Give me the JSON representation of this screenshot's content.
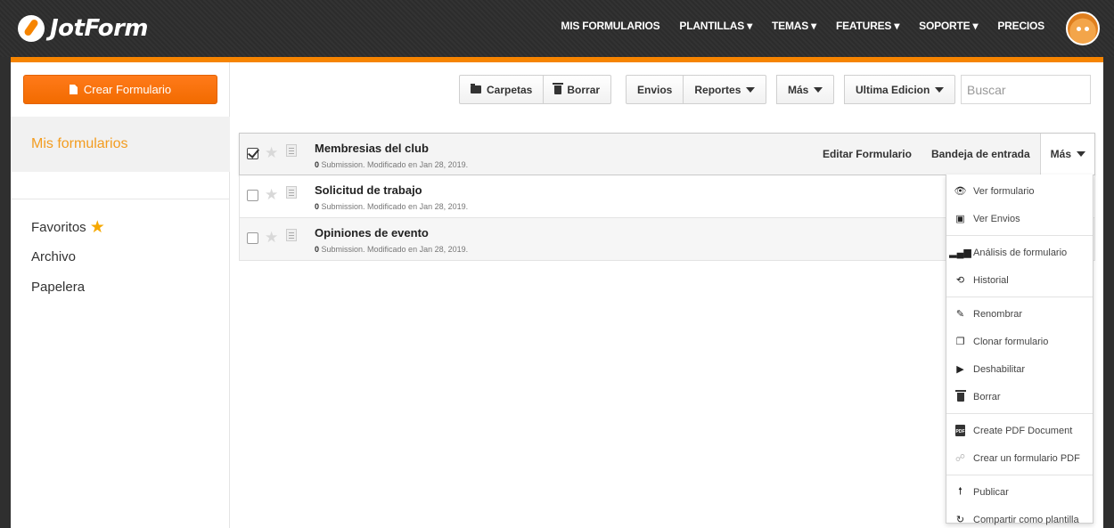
{
  "brand": {
    "name": "JotForm"
  },
  "nav": [
    {
      "label": "MIS FORMULARIOS"
    },
    {
      "label": "PLANTILLAS ▾"
    },
    {
      "label": "TEMAS ▾"
    },
    {
      "label": "FEATURES ▾"
    },
    {
      "label": "SOPORTE ▾"
    },
    {
      "label": "PRECIOS"
    }
  ],
  "sidebar": {
    "create_label": "Crear Formulario",
    "active_label": "Mis formularios",
    "links": [
      {
        "label": "Favoritos"
      },
      {
        "label": "Archivo"
      },
      {
        "label": "Papelera"
      }
    ]
  },
  "toolbar": {
    "carpetas": "Carpetas",
    "borrar": "Borrar",
    "envios": "Envios",
    "reportes": "Reportes",
    "mas": "Más",
    "sort": "Ultima Edicion",
    "search_placeholder": "Buscar"
  },
  "forms": [
    {
      "title": "Membresias del club",
      "count": "0",
      "meta": " Submission. Modificado en Jan 28, 2019."
    },
    {
      "title": "Solicitud de trabajo",
      "count": "0",
      "meta": " Submission. Modificado en Jan 28, 2019."
    },
    {
      "title": "Opiniones de evento",
      "count": "0",
      "meta": " Submission. Modificado en Jan 28, 2019."
    }
  ],
  "row_actions": {
    "edit": "Editar Formulario",
    "inbox": "Bandeja de entrada",
    "more": "Más"
  },
  "dropdown": {
    "ver_formulario": "Ver formulario",
    "ver_envios": "Ver Envios",
    "analisis": "Análisis de formulario",
    "historial": "Historial",
    "renombrar": "Renombrar",
    "clonar": "Clonar formulario",
    "deshabilitar": "Deshabilitar",
    "borrar": "Borrar",
    "create_pdf": "Create PDF Document",
    "crear_pdf_form": "Crear un formulario PDF",
    "publicar": "Publicar",
    "compartir": "Compartir como plantilla",
    "pdf_badge": "PDF"
  },
  "colors": {
    "accent": "#f68400",
    "active_text": "#f39c1f",
    "star": "#f6a800"
  }
}
